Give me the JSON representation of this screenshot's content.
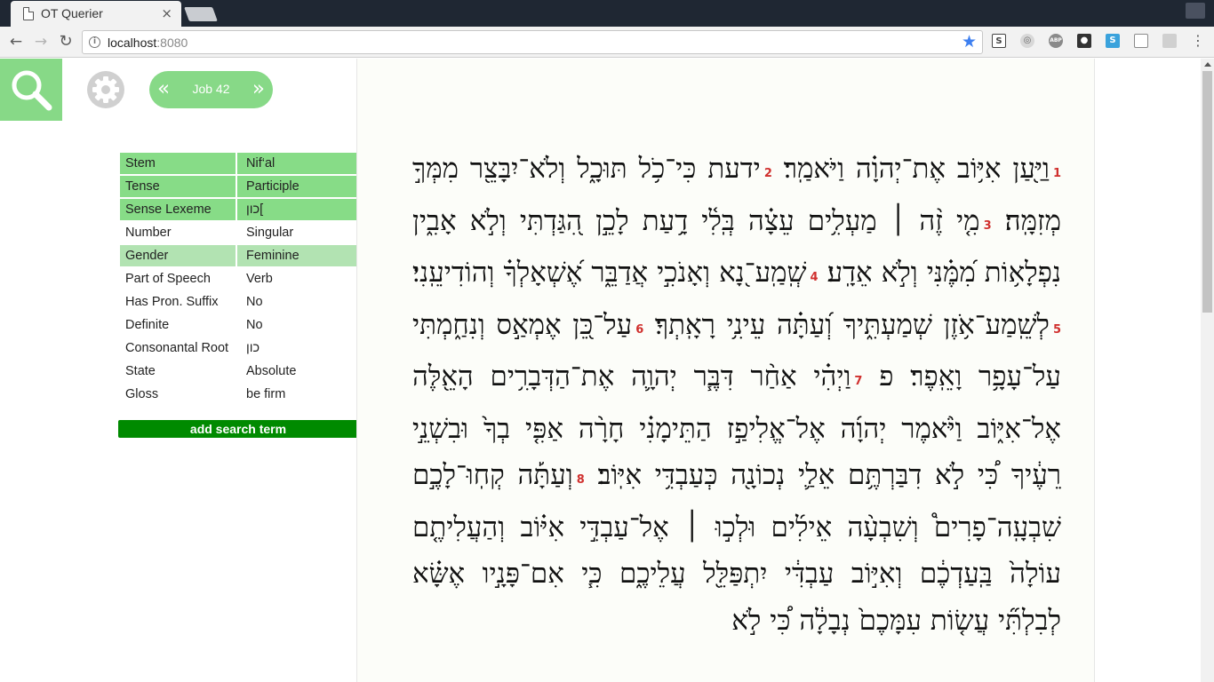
{
  "browser": {
    "tab_title": "OT Querier",
    "tab_close": "×",
    "url_host": "localhost",
    "url_port": ":8080",
    "star": "★"
  },
  "app": {
    "chapter": "Job 42",
    "prev": "«",
    "next": "»"
  },
  "attributes": [
    {
      "key": "Stem",
      "value": "Nif‘al",
      "state": "selected"
    },
    {
      "key": "Tense",
      "value": "Participle",
      "state": "selected"
    },
    {
      "key": "Sense Lexeme",
      "value": "כון[",
      "state": "selected"
    },
    {
      "key": "Number",
      "value": "Singular",
      "state": "none"
    },
    {
      "key": "Gender",
      "value": "Feminine",
      "state": "hover"
    },
    {
      "key": "Part of Speech",
      "value": "Verb",
      "state": "none"
    },
    {
      "key": "Has Pron. Suffix",
      "value": "No",
      "state": "none"
    },
    {
      "key": "Definite",
      "value": "No",
      "state": "none"
    },
    {
      "key": "Consonantal Root",
      "value": "כון",
      "state": "none"
    },
    {
      "key": "State",
      "value": "Absolute",
      "state": "none"
    },
    {
      "key": "Gloss",
      "value": "be firm",
      "state": "none"
    }
  ],
  "add_term": "add search term",
  "colors": {
    "accent_green": "#87d987",
    "selected_row": "#87dc87",
    "hover_row": "#b2e3b2",
    "button_green": "#008a00",
    "verse_number": "#d0302e"
  },
  "text": {
    "verses": [
      {
        "n": "1",
        "text": "וַיַּ֖עַן אִיּ֥וֹב אֶת־יְהוָ֗ה וַיֹּאמַֽר׃"
      },
      {
        "n": "2",
        "text": "ידעת כִּי־כֹ֥ל תּוּכָ֑ל וְלֹא־יִבָּצֵ֖ר מִמְּךָ֣ מְזִמָּֽה׃"
      },
      {
        "n": "3",
        "text": "מִ֤י זֶ֨ה ׀ מַעְלִ֥ים עֵצָ֗ה בְּֽלִ֫י דָ֥עַת לָכֵ֣ן הִ֭גַּדְתִּי וְלֹ֣א אָבִ֑ין נִפְלָא֥וֹת מִ֝מֶּ֗נִּי וְלֹ֣א אֵדָֽע׃"
      },
      {
        "n": "4",
        "text": "שְֽׁמַֽע־נָ֭א וְאָנֹכִ֣י אֲדַבֵּ֑ר אֶ֝שְׁאָלְךָ֗ וְהוֹדִיעֵֽנִי׃"
      },
      {
        "n": "5",
        "text": "לְשֵֽׁמַע־אֹ֥זֶן שְׁמַעְתִּ֑יךָ וְ֝עַתָּ֗ה עֵינִ֥י רָאָֽתְךָ׃"
      },
      {
        "n": "6",
        "text": "עַל־כֵּ֭ן אֶמְאַ֣ס וְנִחַ֑מְתִּי עַל־עָפָ֥ר וָאֵֽפֶר׃ פ"
      },
      {
        "n": "7",
        "text": "וַיְהִ֗י אַחַ֨ר דִּבֶּ֧ר יְהוָ֛ה אֶת־הַדְּבָרִ֥ים הָאֵ֖לֶּה אֶל־אִיּ֑וֹב וַיֹּ֨אמֶר יְהוָ֜ה אֶל־אֱלִיפַ֣ז הַתֵּימָנִ֗י חָרָ֨ה אַפִּ֤י בְךָ֙ וּבִשְׁנֵ֣י רֵעֶ֔יךָ כִּ֠י לֹ֣א דִבַּרְתֶּ֥ם אֵלַ֛י נְכוֹנָ֖ה כְּעַבְדִּ֥י אִיּֽוֹב׃"
      },
      {
        "n": "8",
        "text": "וְעַתָּ֡ה קְחֽוּ־לָכֶ֣ם שִׁבְעָֽה־פָרִים֩ וְשִׁבְעָ֨ה אֵילִ֜ים וּלְכ֣וּ ׀ אֶל־עַבְדִּ֣י אִיּ֗וֹב וְהַעֲלִיתֶ֤ם עוֹלָה֙ בַּֽעַדְכֶ֔ם וְאִיּ֣וֹב עַבְדִּ֔י יִתְפַּלֵּ֖ל עֲלֵיכֶ֑ם כִּ֧י אִם־פָּנָ֣יו אֶשָּׂ֗א לְבִלְתִּ֞י עֲשׂ֤וֹת עִמָּכֶם֙ נְבָלָ֔ה כִּ֠י לֹ֣א"
      }
    ]
  }
}
